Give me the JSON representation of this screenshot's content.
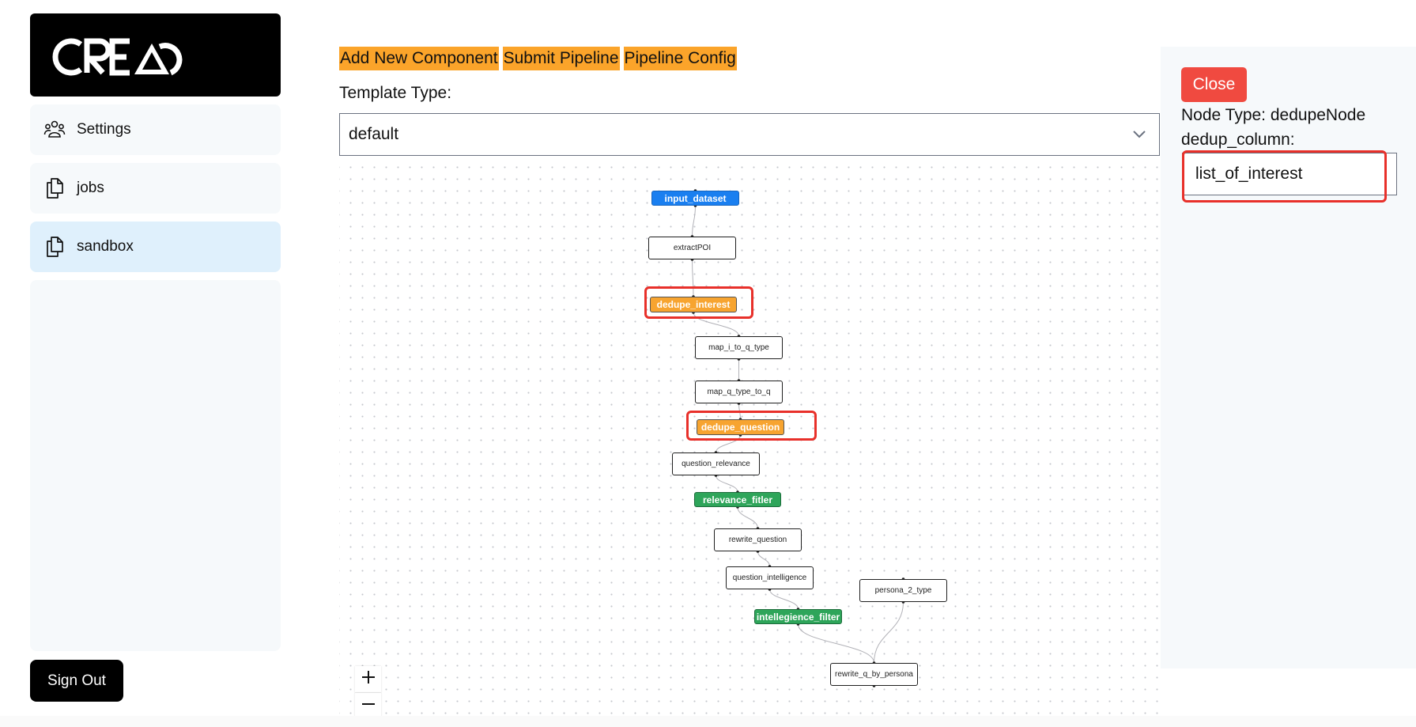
{
  "brand": {
    "logo_text": "CREAO"
  },
  "sidebar": {
    "items": [
      {
        "label": "Settings",
        "icon": "users-icon",
        "active": false
      },
      {
        "label": "jobs",
        "icon": "documents-icon",
        "active": false
      },
      {
        "label": "sandbox",
        "icon": "documents-icon",
        "active": true
      }
    ],
    "sign_out_label": "Sign Out"
  },
  "toolbar": {
    "add_component_label": "Add New Component",
    "submit_pipeline_label": "Submit Pipeline",
    "pipeline_config_label": "Pipeline Config"
  },
  "template": {
    "label": "Template Type:",
    "selected": "default"
  },
  "pipeline": {
    "nodes": [
      {
        "id": "input_dataset",
        "label": "input_dataset",
        "kind": "input"
      },
      {
        "id": "extractPOI",
        "label": "extractPOI",
        "kind": "default"
      },
      {
        "id": "dedupe_interest",
        "label": "dedupe_interest",
        "kind": "dedupe",
        "highlighted": true
      },
      {
        "id": "map_i_to_q_type",
        "label": "map_i_to_q_type",
        "kind": "default"
      },
      {
        "id": "map_q_type_to_q",
        "label": "map_q_type_to_q",
        "kind": "default"
      },
      {
        "id": "dedupe_question",
        "label": "dedupe_question",
        "kind": "dedupe",
        "highlighted": true
      },
      {
        "id": "question_relevance",
        "label": "question_relevance",
        "kind": "default"
      },
      {
        "id": "relevance_fitler",
        "label": "relevance_fitler",
        "kind": "filter"
      },
      {
        "id": "rewrite_question",
        "label": "rewrite_question",
        "kind": "default"
      },
      {
        "id": "question_intelligence",
        "label": "question_intelligence",
        "kind": "default"
      },
      {
        "id": "persona_2_type",
        "label": "persona_2_type",
        "kind": "default"
      },
      {
        "id": "intellegience_filter",
        "label": "intellegience_filter",
        "kind": "filter"
      },
      {
        "id": "rewrite_q_by_persona",
        "label": "rewrite_q_by_persona",
        "kind": "default"
      }
    ],
    "edges": [
      [
        "input_dataset",
        "extractPOI"
      ],
      [
        "extractPOI",
        "dedupe_interest"
      ],
      [
        "dedupe_interest",
        "map_i_to_q_type"
      ],
      [
        "map_i_to_q_type",
        "map_q_type_to_q"
      ],
      [
        "map_q_type_to_q",
        "dedupe_question"
      ],
      [
        "dedupe_question",
        "question_relevance"
      ],
      [
        "question_relevance",
        "relevance_fitler"
      ],
      [
        "relevance_fitler",
        "rewrite_question"
      ],
      [
        "rewrite_question",
        "question_intelligence"
      ],
      [
        "question_intelligence",
        "intellegience_filter"
      ],
      [
        "intellegience_filter",
        "rewrite_q_by_persona"
      ],
      [
        "persona_2_type",
        "rewrite_q_by_persona"
      ]
    ],
    "zoom_in_label": "+",
    "zoom_out_label": "−"
  },
  "colors": {
    "input_node": "#1a7ff0",
    "dedupe_node": "#f7a430",
    "filter_node": "#2ea55a",
    "toolbar_button": "#fba42a",
    "close_button": "#f04a40",
    "highlight": "#e8302a"
  },
  "detail_panel": {
    "close_label": "Close",
    "node_type_text": "Node Type: dedupeNode",
    "field_label": "dedup_column:",
    "field_value": "list_of_interest"
  }
}
